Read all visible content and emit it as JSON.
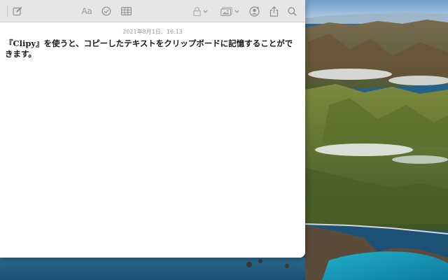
{
  "window": {
    "app": "Notes"
  },
  "toolbar": {
    "icons": [
      "compose-icon",
      "format-text-icon",
      "checklist-icon",
      "table-icon",
      "lock-icon",
      "chevron-down-icon",
      "media-icon",
      "chevron-down-icon",
      "collaborate-icon",
      "share-icon",
      "search-icon"
    ],
    "format_label": "Aa"
  },
  "note": {
    "date": "2021年8月1日、16:13",
    "text": "『Clipy』を使うと、コピーしたテキストをクリップボードに記憶することができます。"
  },
  "colors": {
    "toolbar_bg": "#e6e6e6",
    "icon_gray": "#8e8e8e",
    "date_gray": "#9a9a9a",
    "text": "#1a1a1a",
    "note_bg": "#ffffff"
  }
}
